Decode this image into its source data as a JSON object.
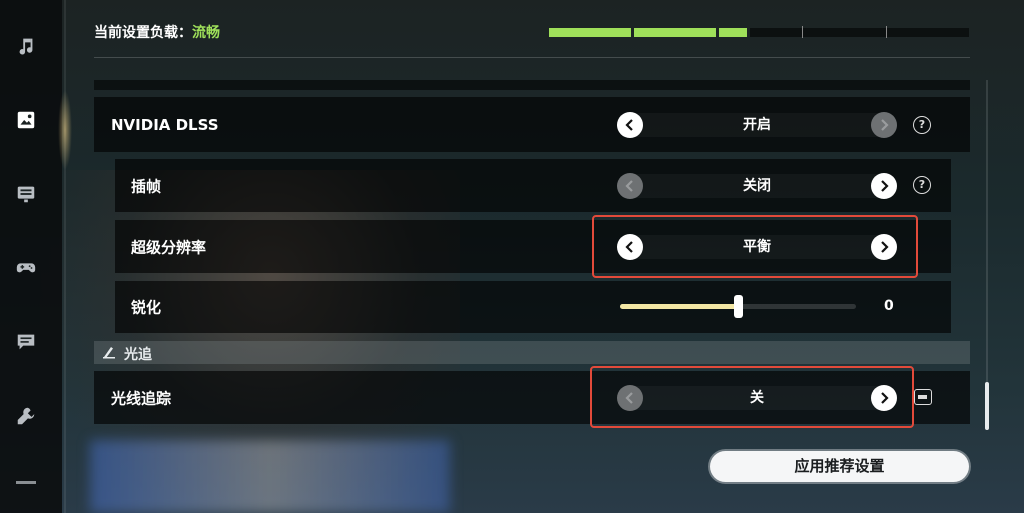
{
  "header": {
    "load_label": "当前设置负载：",
    "load_value": "流畅",
    "load_segments": 3,
    "load_total_segments": 5
  },
  "sidebar": {
    "items": [
      {
        "icon": "music-note-icon",
        "active": false
      },
      {
        "icon": "image-icon",
        "active": true
      },
      {
        "icon": "display-settings-icon",
        "active": false
      },
      {
        "icon": "gamepad-icon",
        "active": false
      },
      {
        "icon": "chat-icon",
        "active": false
      },
      {
        "icon": "wrench-icon",
        "active": false
      }
    ]
  },
  "settings": {
    "dlss": {
      "label": "NVIDIA DLSS",
      "value": "开启",
      "left_enabled": true,
      "right_enabled": false,
      "help": "?"
    },
    "frame_gen": {
      "label": "插帧",
      "value": "关闭",
      "left_enabled": false,
      "right_enabled": true,
      "help": "?"
    },
    "super_res": {
      "label": "超级分辨率",
      "value": "平衡",
      "left_enabled": true,
      "right_enabled": true
    },
    "sharpen": {
      "label": "锐化",
      "value": "0",
      "level": 0.5
    }
  },
  "ray_section": {
    "title": "光追",
    "ray_tracing": {
      "label": "光线追踪",
      "value": "关",
      "left_enabled": false,
      "right_enabled": true
    }
  },
  "apply_button": "应用推荐设置",
  "colors": {
    "accent_green": "#9fe05a",
    "highlight_red": "#e24a3a",
    "slider_fill": "#f3e7a4"
  }
}
